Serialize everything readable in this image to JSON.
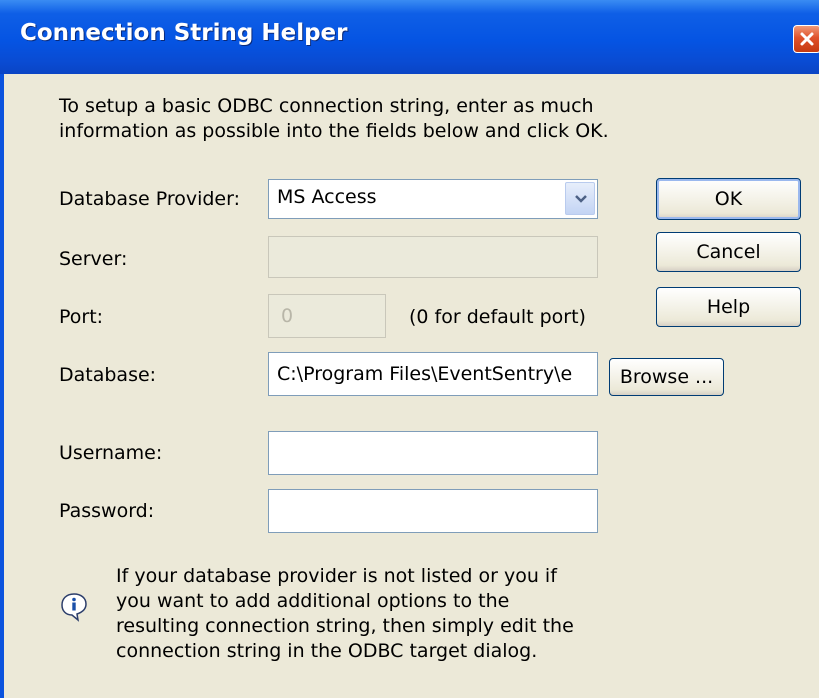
{
  "window": {
    "title": "Connection String Helper"
  },
  "intro": {
    "text": "To setup a basic ODBC connection string, enter as much information as possible into the fields below and click OK."
  },
  "fields": {
    "provider": {
      "label": "Database Provider:",
      "value": "MS Access"
    },
    "server": {
      "label": "Server:",
      "value": ""
    },
    "port": {
      "label": "Port:",
      "value": "0",
      "hint": "(0 for default port)"
    },
    "database": {
      "label": "Database:",
      "value": "C:\\Program Files\\EventSentry\\e"
    },
    "username": {
      "label": "Username:",
      "value": ""
    },
    "password": {
      "label": "Password:",
      "value": ""
    }
  },
  "buttons": {
    "ok": "OK",
    "cancel": "Cancel",
    "help": "Help",
    "browse": "Browse ..."
  },
  "note": {
    "text": "If your database provider is not listed or you if you want to add additional options to the resulting connection string, then simply edit the connection string in the ODBC target dialog."
  },
  "icons": {
    "close": "close-icon",
    "dropdown": "chevron-down-icon",
    "info": "info-icon"
  }
}
